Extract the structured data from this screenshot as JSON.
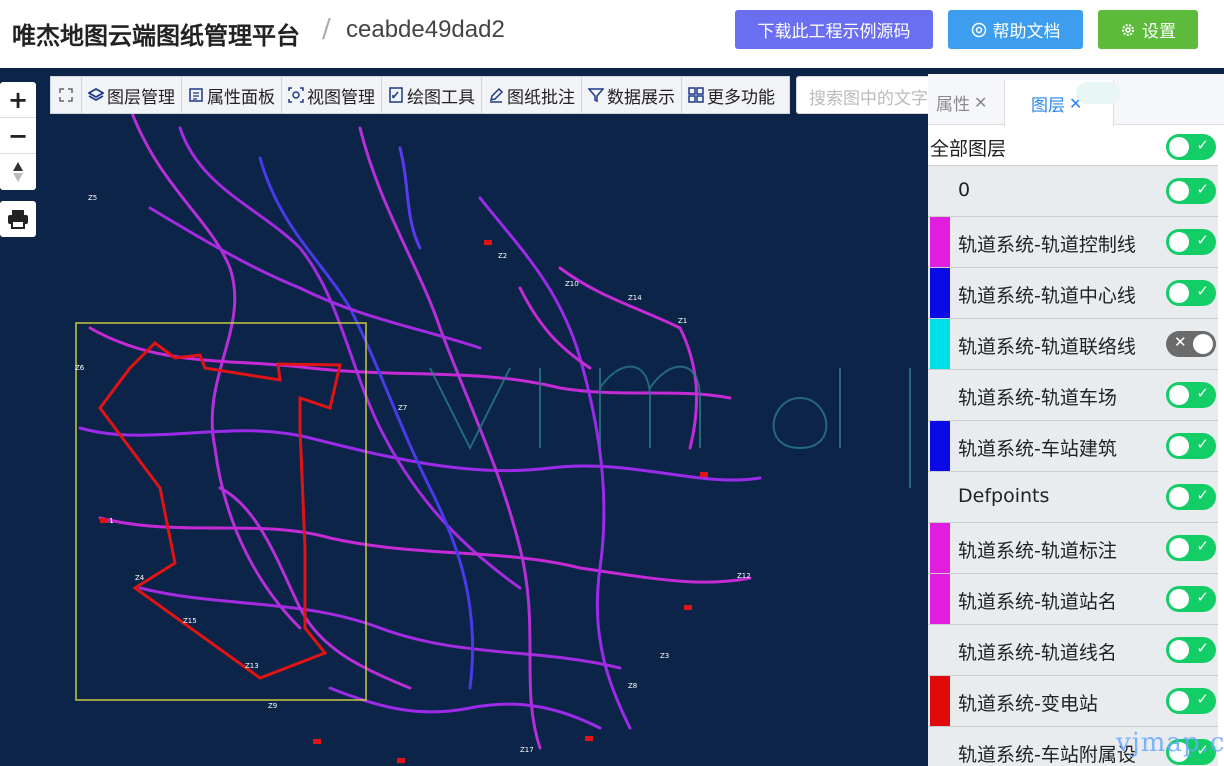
{
  "header": {
    "title": "唯杰地图云端图纸管理平台",
    "separator": "/",
    "project_id": "ceabde49dad2",
    "download_label": "下载此工程示例源码",
    "help_label": "帮助文档",
    "settings_label": "设置"
  },
  "toolbar": {
    "items": [
      "图层管理",
      "属性面板",
      "视图管理",
      "绘图工具",
      "图纸批注",
      "数据展示",
      "更多功能"
    ]
  },
  "search": {
    "placeholder": "搜索图中的文字"
  },
  "panel": {
    "tab_props": "属性",
    "tab_layers": "图层",
    "all_layers_label": "全部图层",
    "layers": [
      {
        "name": "0",
        "color": "#e9ecef",
        "visible": true
      },
      {
        "name": "轨道系统-轨道控制线",
        "color": "#e01ee0",
        "visible": true
      },
      {
        "name": "轨道系统-轨道中心线",
        "color": "#0a0ae6",
        "visible": true
      },
      {
        "name": "轨道系统-轨道联络线",
        "color": "#00e0e8",
        "visible": false
      },
      {
        "name": "轨道系统-轨道车场",
        "color": "#e9ecef",
        "visible": true
      },
      {
        "name": "轨道系统-车站建筑",
        "color": "#0a0ae6",
        "visible": true
      },
      {
        "name": "Defpoints",
        "color": "#e9ecef",
        "visible": true
      },
      {
        "name": "轨道系统-轨道标注",
        "color": "#e01ee0",
        "visible": true
      },
      {
        "name": "轨道系统-轨道站名",
        "color": "#e01ee0",
        "visible": true
      },
      {
        "name": "轨道系统-轨道线名",
        "color": "#e9ecef",
        "visible": true
      },
      {
        "name": "轨道系统-变电站",
        "color": "#e00a0a",
        "visible": true
      },
      {
        "name": "轨道系统-车站附属设",
        "color": "#e9ecef",
        "visible": true
      }
    ]
  },
  "watermark": "vjmap.com",
  "map_watermark": "vjmap",
  "map_labels": [
    "Z2",
    "Z10",
    "Z14",
    "Z1",
    "Z7",
    "Z5",
    "Z12",
    "Z15",
    "Z13",
    "Z11",
    "Z3",
    "Z9",
    "Z17",
    "Z8",
    "Z4",
    "Z6"
  ],
  "colors": {
    "map_bg": "#0b2447",
    "line_magenta": "#c42bd6",
    "line_blue": "#3a3ae8",
    "line_red": "#e01414",
    "box": "#c8c840"
  }
}
